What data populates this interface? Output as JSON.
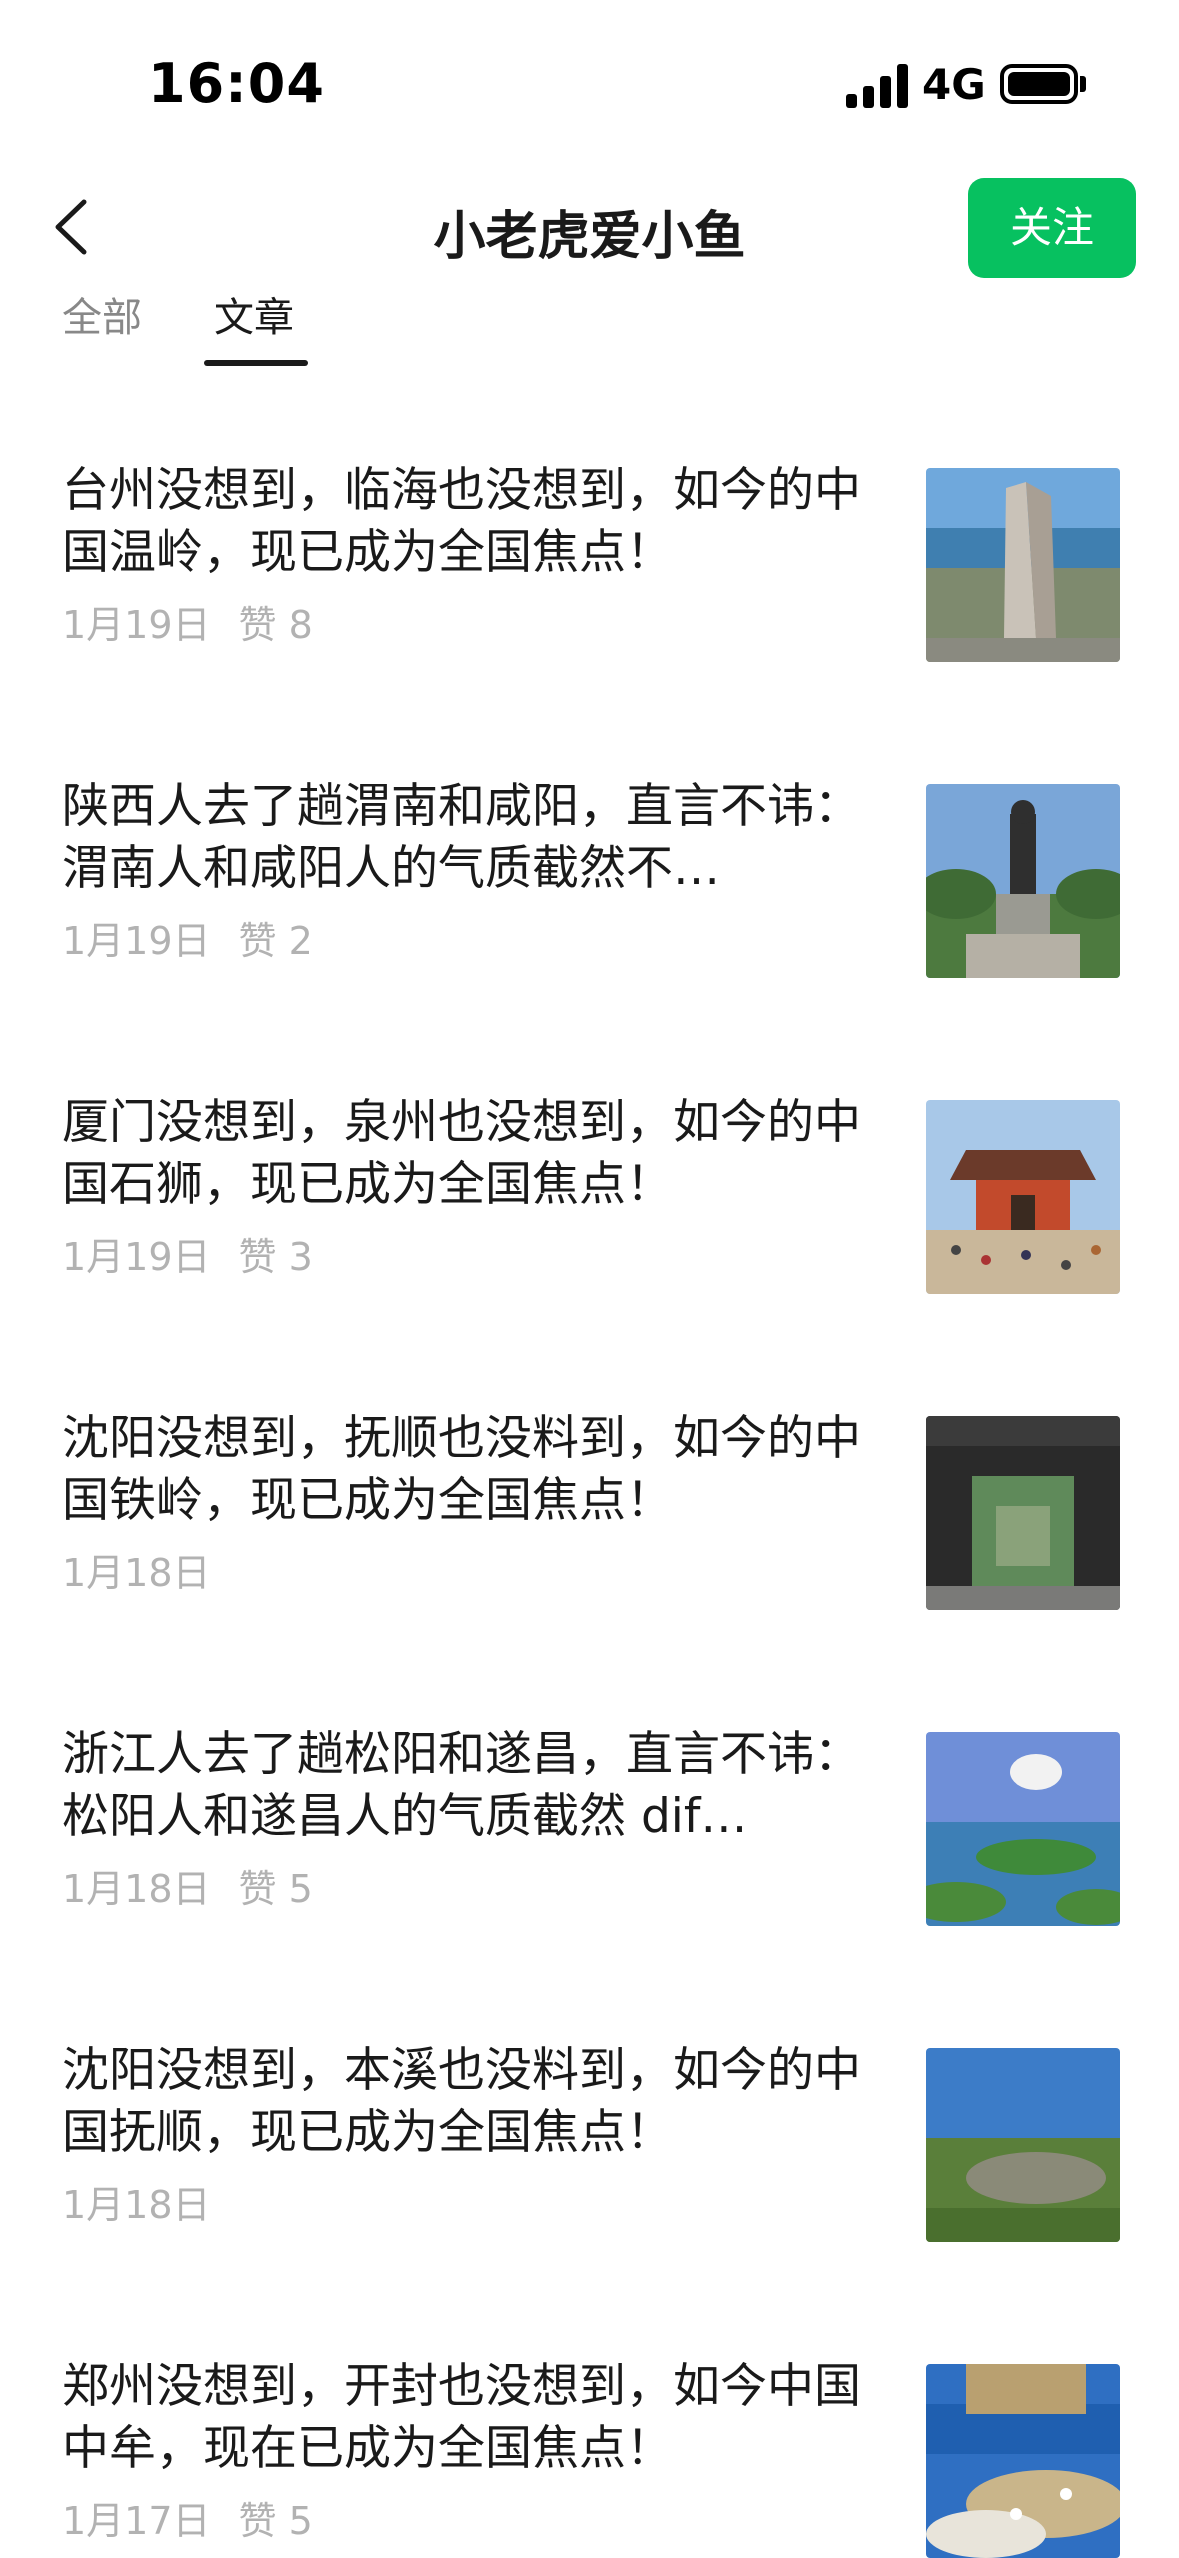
{
  "status_bar": {
    "time": "16:04",
    "network": "4G",
    "signal_icon": "cellular-signal-icon",
    "battery_icon": "battery-icon"
  },
  "header": {
    "back_icon": "chevron-left-icon",
    "title": "小老虎爱小鱼",
    "follow_label": "关注",
    "accent_color": "#07c160"
  },
  "tabs": [
    {
      "label": "全部",
      "active": false
    },
    {
      "label": "文章",
      "active": true
    }
  ],
  "articles": [
    {
      "title": "台州没想到，临海也没想到，如今的中国温岭，现已成为全国焦点！",
      "date": "1月19日",
      "likes": "赞 8"
    },
    {
      "title": "陕西人去了趟渭南和咸阳，直言不讳：渭南人和咸阳人的气质截然不…",
      "date": "1月19日",
      "likes": "赞 2"
    },
    {
      "title": "厦门没想到，泉州也没想到，如今的中国石狮，现已成为全国焦点！",
      "date": "1月19日",
      "likes": "赞 3"
    },
    {
      "title": "沈阳没想到，抚顺也没料到，如今的中国铁岭，现已成为全国焦点！",
      "date": "1月18日",
      "likes": ""
    },
    {
      "title": "浙江人去了趟松阳和遂昌，直言不讳：松阳人和遂昌人的气质截然 dif…",
      "date": "1月18日",
      "likes": "赞 5"
    },
    {
      "title": "沈阳没想到，本溪也没料到，如今的中国抚顺，现已成为全国焦点！",
      "date": "1月18日",
      "likes": ""
    },
    {
      "title": "郑州没想到，开封也没想到，如今中国中牟，现在已成为全国焦点！",
      "date": "1月17日",
      "likes": "赞 5"
    }
  ]
}
